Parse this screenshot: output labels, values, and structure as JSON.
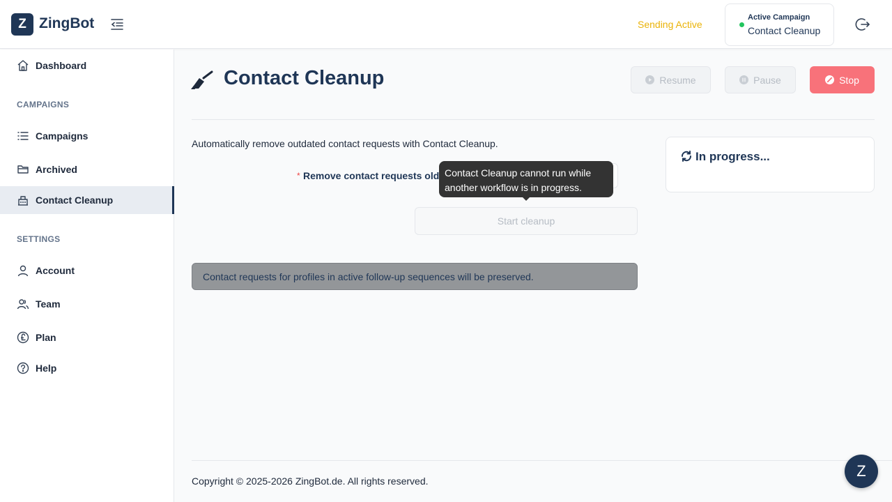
{
  "app": {
    "logo_letter": "Z",
    "name": "ZingBot"
  },
  "header": {
    "status": "Sending Active",
    "active_campaign_label": "Active Campaign",
    "active_campaign_name": "Contact Cleanup"
  },
  "sidebar": {
    "dashboard": "Dashboard",
    "campaigns_section": "CAMPAIGNS",
    "campaigns": "Campaigns",
    "archived": "Archived",
    "contact_cleanup": "Contact Cleanup",
    "settings_section": "SETTINGS",
    "account": "Account",
    "team": "Team",
    "plan": "Plan",
    "help": "Help",
    "active_item": "contact_cleanup"
  },
  "page": {
    "title": "Contact Cleanup",
    "resume_label": "Resume",
    "pause_label": "Pause",
    "stop_label": "Stop",
    "description": "Automatically remove outdated contact requests with Contact Cleanup.",
    "required_marker": "*",
    "field_label": "Remove contact requests older than:",
    "tooltip": "Contact Cleanup cannot run while another workflow is in progress.",
    "start_button": "Start cleanup",
    "info_message": "Contact requests for profiles in active follow-up sequences will be preserved.",
    "progress_status": "In progress..."
  },
  "footer": {
    "copyright": "Copyright © 2025-2026 ZingBot.de. All rights reserved."
  },
  "fab": {
    "label": "Z"
  },
  "colors": {
    "brand": "#1f3656",
    "status_warning": "#eab308",
    "status_active_dot": "#22c55e",
    "stop": "#f8727a",
    "required": "#ef4444"
  },
  "icons": {
    "collapse": "menu-collapse-icon",
    "logout": "logout-icon",
    "dashboard": "home-icon",
    "campaigns": "list-icon",
    "archived": "folder-icon",
    "contact_cleanup": "building-icon",
    "account": "user-icon",
    "team": "users-icon",
    "plan": "pound-icon",
    "help": "question-icon",
    "page": "broom-icon",
    "progress": "refresh-icon"
  }
}
